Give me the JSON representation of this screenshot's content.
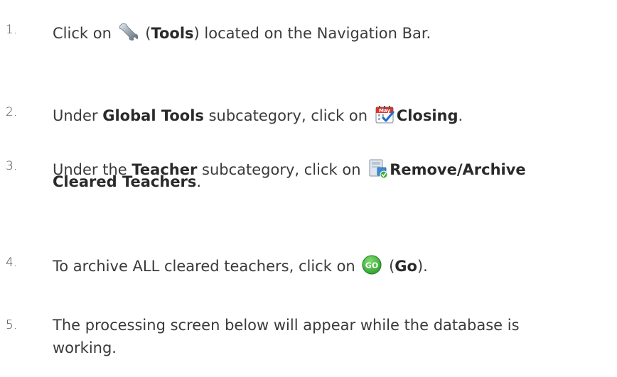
{
  "steps": [
    {
      "number": "1.",
      "pre": "Click on ",
      "icon": "wrench-tools-icon",
      "open_paren": " (",
      "bold": "Tools",
      "post": ") located on the Navigation Bar."
    },
    {
      "number": "2.",
      "pre": "Under ",
      "bold1": "Global Tools",
      "mid": " subcategory, click on ",
      "icon": "calendar-may-closing-icon",
      "bold2": "Closing",
      "post": "."
    },
    {
      "number": "3.",
      "pre": "Under the ",
      "bold1": "Teacher",
      "mid": " subcategory, click on ",
      "icon": "remove-archive-icon",
      "bold2": "Remove/Archive",
      "line2_bold": "Cleared Teachers",
      "line2_post": "."
    },
    {
      "number": "4.",
      "pre": "To archive ALL cleared teachers, click on ",
      "icon": "go-button-icon",
      "icon_text": "GO",
      "open_paren": " (",
      "bold": "Go",
      "post": ")."
    },
    {
      "number": "5.",
      "line1": "The processing screen below will appear while the database is",
      "line2": "working."
    }
  ],
  "colors": {
    "text": "#3a3a3a",
    "go_green": "#3fae3a"
  }
}
